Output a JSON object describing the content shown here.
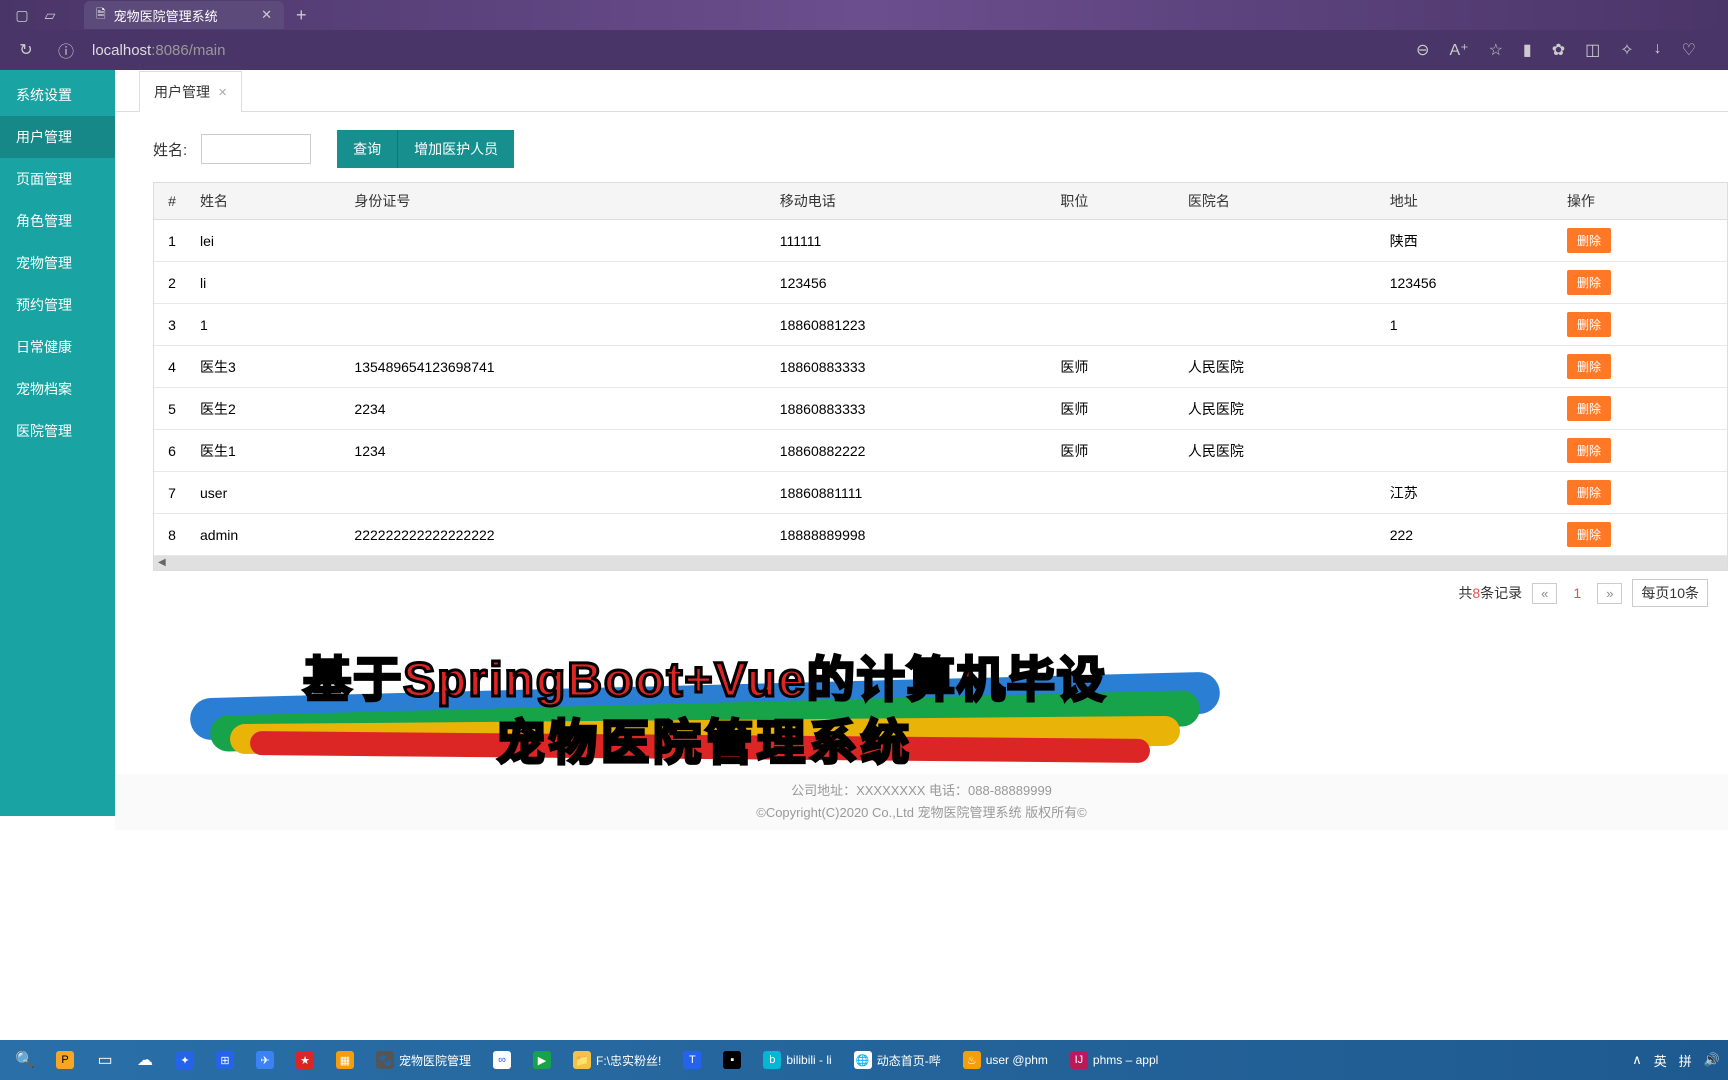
{
  "browser": {
    "tab_title": "宠物医院管理系统",
    "url_host": "localhost",
    "url_port": ":8086",
    "url_path": "/main"
  },
  "sidebar": {
    "items": [
      {
        "label": "系统设置"
      },
      {
        "label": "用户管理"
      },
      {
        "label": "页面管理"
      },
      {
        "label": "角色管理"
      },
      {
        "label": "宠物管理"
      },
      {
        "label": "预约管理"
      },
      {
        "label": "日常健康"
      },
      {
        "label": "宠物档案"
      },
      {
        "label": "医院管理"
      }
    ]
  },
  "page_tab": {
    "label": "用户管理"
  },
  "search": {
    "label": "姓名:",
    "value": "",
    "btn_search": "查询",
    "btn_add": "增加医护人员"
  },
  "table": {
    "headers": [
      "#",
      "姓名",
      "身份证号",
      "移动电话",
      "职位",
      "医院名",
      "地址",
      "操作"
    ],
    "delete_label": "删除",
    "rows": [
      {
        "idx": "1",
        "name": "lei",
        "idcard": "",
        "phone": "111111",
        "role": "",
        "hospital": "",
        "addr": "陕西"
      },
      {
        "idx": "2",
        "name": "li",
        "idcard": "",
        "phone": "123456",
        "role": "",
        "hospital": "",
        "addr": "123456"
      },
      {
        "idx": "3",
        "name": "1",
        "idcard": "",
        "phone": "18860881223",
        "role": "",
        "hospital": "",
        "addr": "1"
      },
      {
        "idx": "4",
        "name": "医生3",
        "idcard": "135489654123698741",
        "phone": "18860883333",
        "role": "医师",
        "hospital": "人民医院",
        "addr": ""
      },
      {
        "idx": "5",
        "name": "医生2",
        "idcard": "2234",
        "phone": "18860883333",
        "role": "医师",
        "hospital": "人民医院",
        "addr": ""
      },
      {
        "idx": "6",
        "name": "医生1",
        "idcard": "1234",
        "phone": "18860882222",
        "role": "医师",
        "hospital": "人民医院",
        "addr": ""
      },
      {
        "idx": "7",
        "name": "user",
        "idcard": "",
        "phone": "18860881111",
        "role": "",
        "hospital": "",
        "addr": "江苏"
      },
      {
        "idx": "8",
        "name": "admin",
        "idcard": "222222222222222222",
        "phone": "18888889998",
        "role": "",
        "hospital": "",
        "addr": "222"
      }
    ]
  },
  "pagination": {
    "total_prefix": "共",
    "total_count": "8",
    "total_suffix": "条记录",
    "current_page": "1",
    "per_page": "每页10条"
  },
  "overlay": {
    "line1": "基于SpringBoot+Vue的计算机毕设",
    "line2": "宠物医院管理系统"
  },
  "footer": {
    "line1": "公司地址：XXXXXXXX 电话：088-88889999",
    "line2": "©Copyright(C)2020 Co.,Ltd 宠物医院管理系统 版权所有©"
  },
  "taskbar": {
    "apps": [
      {
        "label": "宠物医院管理"
      },
      {
        "label": "F:\\忠实粉丝!"
      },
      {
        "label": "bilibili - li"
      },
      {
        "label": "动态首页-哔"
      },
      {
        "label": "user @phm"
      },
      {
        "label": "phms – appl"
      }
    ],
    "tray": {
      "up": "∧",
      "ime1": "英",
      "ime2": "拼"
    }
  }
}
